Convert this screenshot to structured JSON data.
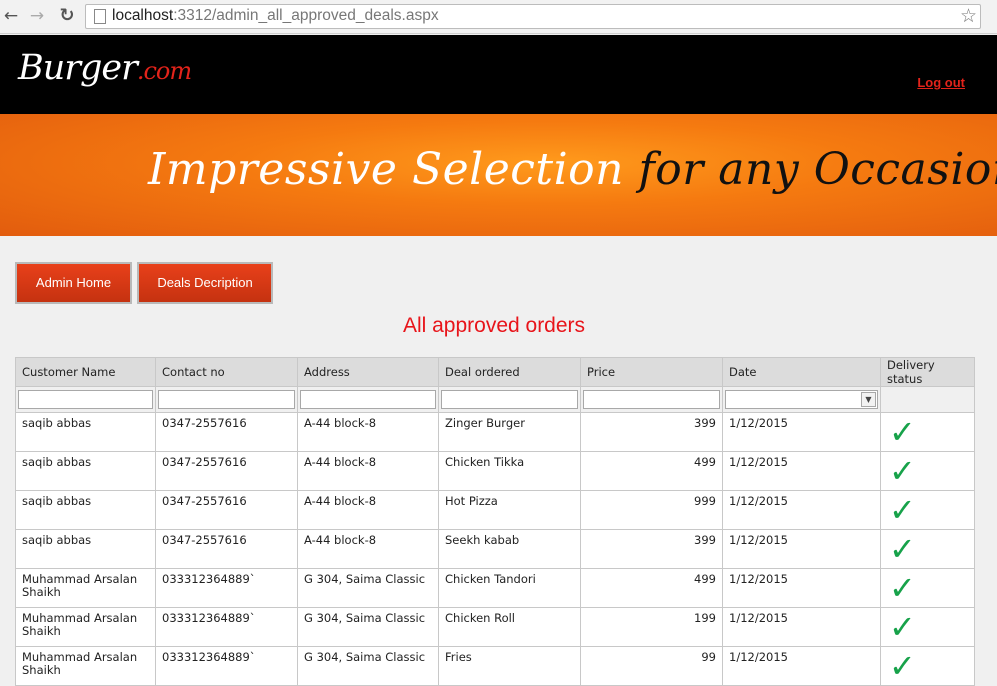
{
  "browser": {
    "url_host": "localhost",
    "url_path": ":3312/admin_all_approved_deals.aspx"
  },
  "header": {
    "logo_main": "Burger",
    "logo_dom": ".com",
    "logout": "Log out"
  },
  "banner": {
    "part1": "Impressive Selection",
    "part2": "for any Occasion"
  },
  "buttons": {
    "admin_home": "Admin Home",
    "deals_description": "Deals Decription"
  },
  "heading": "All approved orders",
  "grid": {
    "columns": [
      "Customer Name",
      "Contact no",
      "Address",
      "Deal ordered",
      "Price",
      "Date",
      "Delivery status"
    ],
    "rows": [
      {
        "customer": "saqib abbas",
        "contact": "0347-2557616",
        "address": "A-44 block-8",
        "deal": "Zinger Burger",
        "price": "399",
        "date": "1/12/2015",
        "status": "✓"
      },
      {
        "customer": "saqib abbas",
        "contact": "0347-2557616",
        "address": "A-44 block-8",
        "deal": "Chicken Tikka",
        "price": "499",
        "date": "1/12/2015",
        "status": "✓"
      },
      {
        "customer": "saqib abbas",
        "contact": "0347-2557616",
        "address": "A-44 block-8",
        "deal": "Hot Pizza",
        "price": "999",
        "date": "1/12/2015",
        "status": "✓"
      },
      {
        "customer": "saqib abbas",
        "contact": "0347-2557616",
        "address": "A-44 block-8",
        "deal": "Seekh kabab",
        "price": "399",
        "date": "1/12/2015",
        "status": "✓"
      },
      {
        "customer": "Muhammad Arsalan Shaikh",
        "contact": "033312364889`",
        "address": "G 304, Saima Classic",
        "deal": "Chicken Tandori",
        "price": "499",
        "date": "1/12/2015",
        "status": "✓"
      },
      {
        "customer": "Muhammad Arsalan Shaikh",
        "contact": "033312364889`",
        "address": "G 304, Saima Classic",
        "deal": "Chicken Roll",
        "price": "199",
        "date": "1/12/2015",
        "status": "✓"
      },
      {
        "customer": "Muhammad Arsalan Shaikh",
        "contact": "033312364889`",
        "address": "G 304, Saima Classic",
        "deal": "Fries",
        "price": "99",
        "date": "1/12/2015",
        "status": "✓"
      }
    ]
  },
  "colors": {
    "accent_red": "#e2231a",
    "button_bg": "#c53210",
    "check_green": "#17a24a"
  }
}
